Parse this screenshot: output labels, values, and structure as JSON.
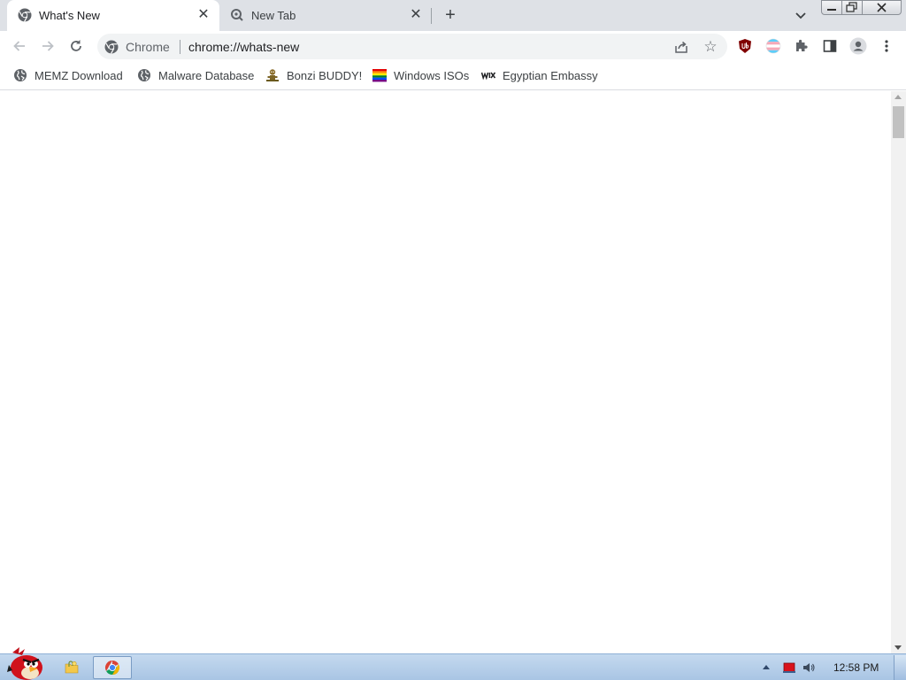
{
  "tabs": [
    {
      "title": "What's New",
      "active": true,
      "icon": "chrome-icon"
    },
    {
      "title": "New Tab",
      "active": false,
      "icon": "chrome-search-icon"
    }
  ],
  "tabstrip": {
    "close_glyph": "✕",
    "new_tab_glyph": "+"
  },
  "omnibox": {
    "chip_label": "Chrome",
    "url": "chrome://whats-new"
  },
  "bookmarks": [
    {
      "label": "MEMZ Download",
      "icon": "globe-icon"
    },
    {
      "label": "Malware Database",
      "icon": "globe-icon"
    },
    {
      "label": "Bonzi BUDDY!",
      "icon": "bonzi-icon"
    },
    {
      "label": "Windows ISOs",
      "icon": "rainbow-flag-icon"
    },
    {
      "label": "Egyptian Embassy",
      "icon": "wix-icon"
    }
  ],
  "taskbar": {
    "clock": "12:58 PM"
  },
  "colors": {
    "tabstrip_bg": "#dee1e6",
    "omnibox_bg": "#f1f3f4",
    "taskbar_top": "#c4d9ef",
    "taskbar_bottom": "#a9c5e4"
  }
}
